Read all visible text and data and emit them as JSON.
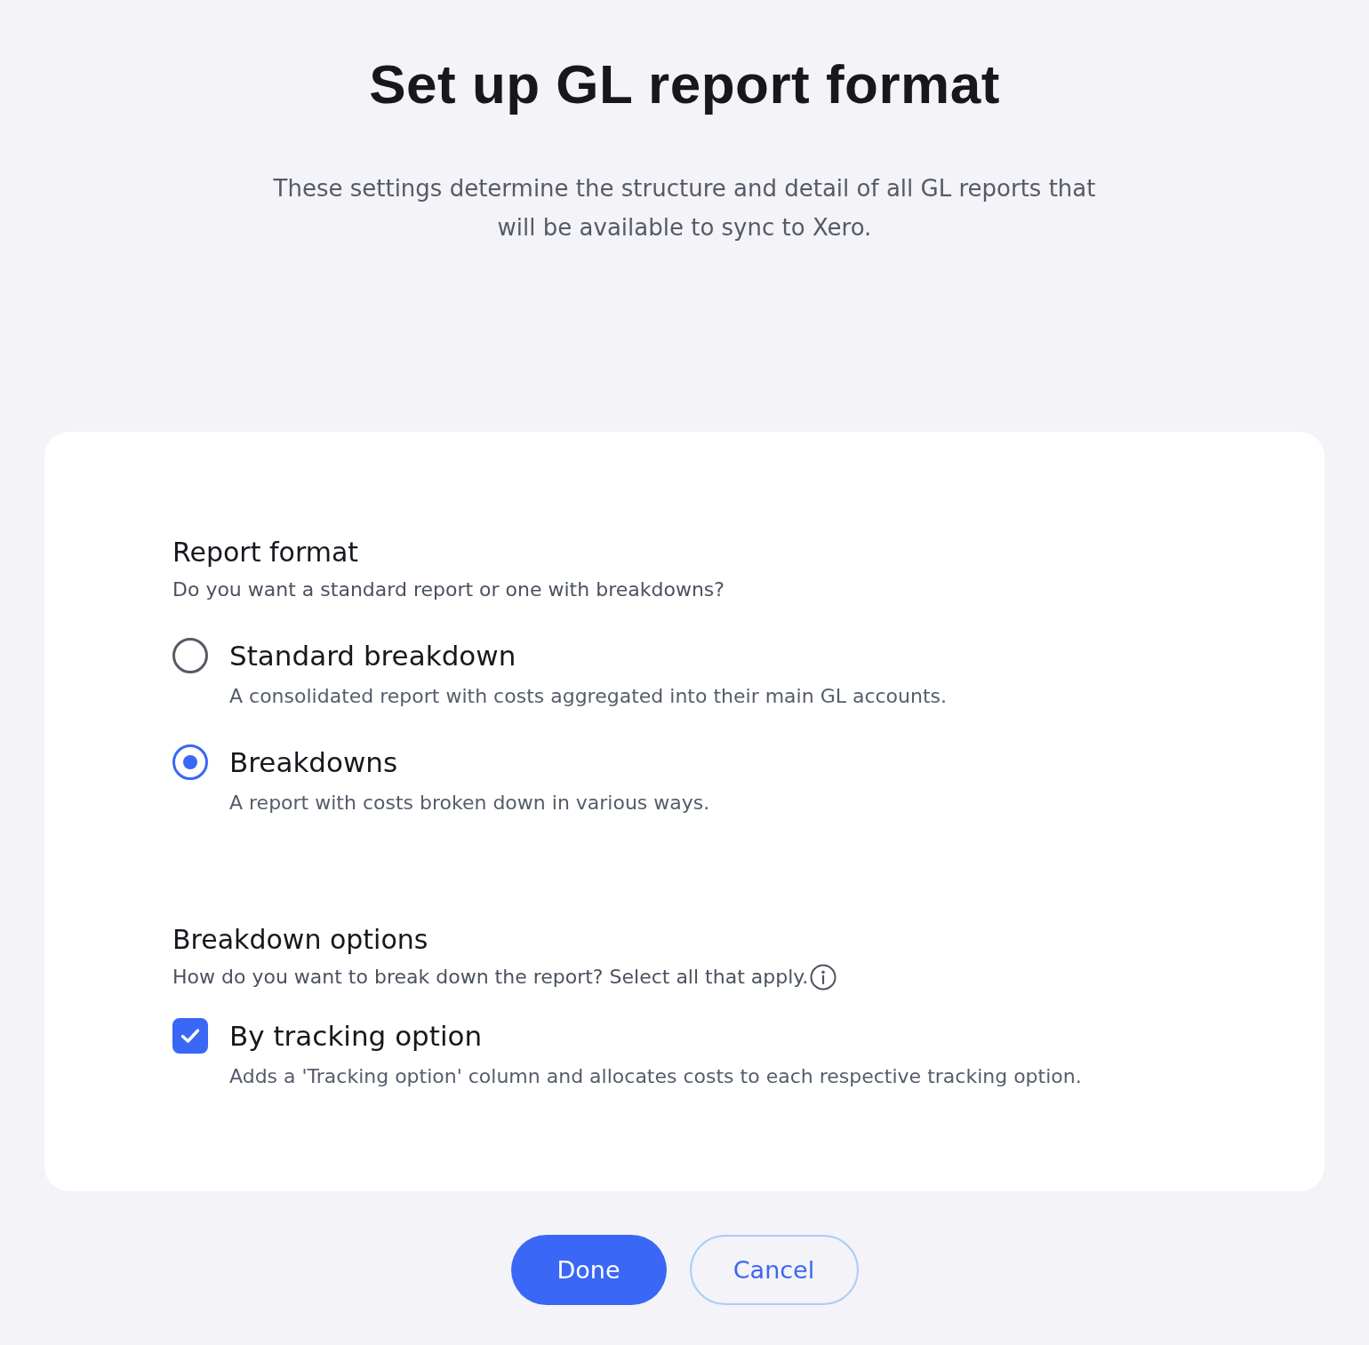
{
  "page": {
    "title": "Set up GL report format",
    "subtitle": "These settings determine the structure and detail of all GL reports that will be available to sync to Xero."
  },
  "sections": [
    {
      "kind": "radio",
      "heading": "Report format",
      "prompt": "Do you want a standard report or one with breakdowns?",
      "info": false,
      "options": [
        {
          "label": "Standard breakdown",
          "description": "A consolidated report with costs aggregated into their main GL accounts.",
          "selected": false
        },
        {
          "label": "Breakdowns",
          "description": "A report with costs broken down in various ways.",
          "selected": true
        }
      ]
    },
    {
      "kind": "checkbox",
      "heading": "Breakdown options",
      "prompt": "How do you want to break down the report? Select all that apply.",
      "info": true,
      "options": [
        {
          "label": "By tracking option",
          "description": "Adds a 'Tracking option' column and allocates costs to each respective tracking option.",
          "checked": true
        }
      ]
    }
  ],
  "buttons": [
    {
      "label": "Done",
      "kind": "primary"
    },
    {
      "label": "Cancel",
      "kind": "secondary"
    }
  ]
}
